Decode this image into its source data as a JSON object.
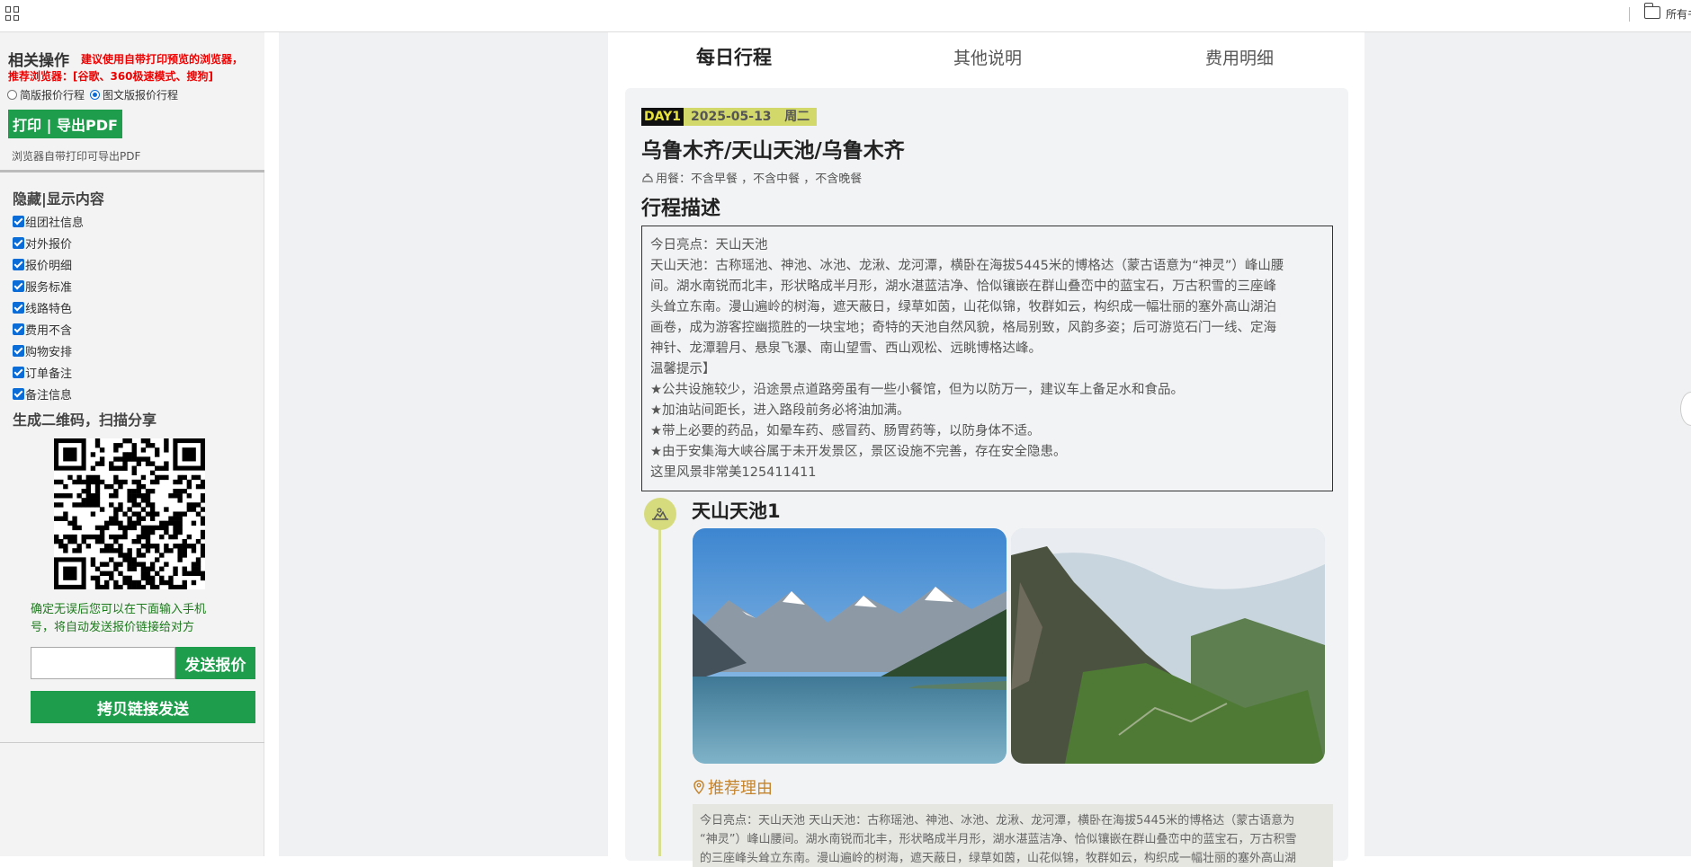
{
  "topbar": {
    "right_label": "所有书签"
  },
  "sidebar": {
    "title": "相关操作",
    "warning_1": "建议使用自带打印预览的浏览器，",
    "warning_2": "推荐浏览器：[谷歌、360极速模式、搜狗]",
    "radio_simple": "简版报价行程",
    "radio_detail": "图文版报价行程",
    "print_button": "打印 | 导出PDF",
    "print_note": "浏览器自带打印可导出PDF",
    "toggle_title": "隐藏|显示内容",
    "toggles": [
      "组团社信息",
      "对外报价",
      "报价明细",
      "服务标准",
      "线路特色",
      "费用不含",
      "购物安排",
      "订单备注",
      "备注信息"
    ],
    "qr_title": "生成二维码，扫描分享",
    "confirm_text": "确定无误后您可以在下面输入手机号，将自动发送报价链接给对方",
    "phone_placeholder": "",
    "send_button": "发送报价",
    "copy_button": "拷贝链接发送"
  },
  "tabs": [
    {
      "label": "每日行程",
      "active": true
    },
    {
      "label": "其他说明",
      "active": false
    },
    {
      "label": "费用明细",
      "active": false
    }
  ],
  "day": {
    "badge": "DAY1",
    "date": "2025-05-13",
    "weekday": "周二",
    "route": "乌鲁木齐/天山天池/乌鲁木齐",
    "meal": "用餐：不含早餐 ，不含中餐 ，不含晚餐",
    "desc_title": "行程描述",
    "desc_lines": [
      "今日亮点：天山天池",
      "天山天池：古称瑶池、神池、冰池、龙湫、龙河潭，横卧在海拔5445米的博格达（蒙古语意为“神灵”）峰山腰",
      "间。湖水南锐而北丰，形状略成半月形，湖水湛蓝洁净、恰似镶嵌在群山叠峦中的蓝宝石，万古积雪的三座峰",
      "头耸立东南。漫山遍岭的树海，遮天蔽日，绿草如茵，山花似锦，牧群如云，构织成一幅壮丽的塞外高山湖泊",
      "画卷，成为游客控幽揽胜的一块宝地；奇特的天池自然风貌，格局别致，风韵多姿；后可游览石门一线、定海",
      "神针、龙潭碧月、悬泉飞瀑、南山望雪、西山观松、远眺博格达峰。",
      "温馨提示】",
      "★公共设施较少，沿途景点道路旁虽有一些小餐馆，但为以防万一，建议车上备足水和食品。",
      "★加油站间距长，进入路段前务必将油加满。",
      "★带上必要的药品，如晕车药、感冒药、肠胃药等，以防身体不适。",
      "★由于安集海大峡谷属于未开发景区，景区设施不完善，存在安全隐患。",
      "这里风景非常美125411411"
    ],
    "spot_title": "天山天池1",
    "reason_title": "推荐理由",
    "reason_lines": [
      "今日亮点：天山天池 天山天池：古称瑶池、神池、冰池、龙湫、龙河潭，横卧在海拔5445米的博格达（蒙古语意为",
      "“神灵”）峰山腰间。湖水南锐而北丰，形状略成半月形，湖水湛蓝洁净、恰似镶嵌在群山叠峦中的蓝宝石，万古积雪",
      "的三座峰头耸立东南。漫山遍岭的树海，遮天蔽日，绿草如茵，山花似锦，牧群如云，构织成一幅壮丽的塞外高山湖"
    ]
  }
}
